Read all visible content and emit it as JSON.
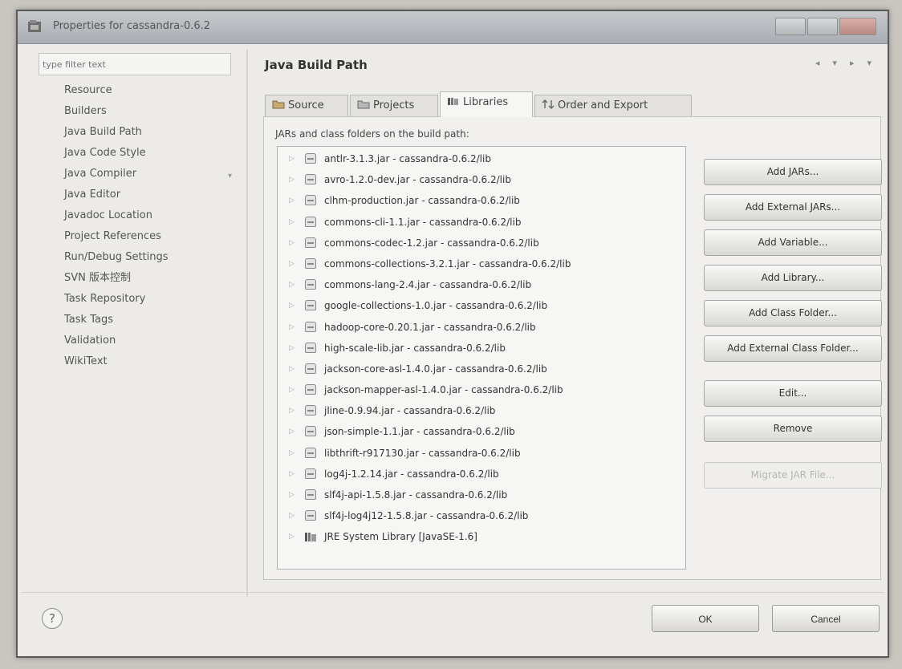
{
  "window": {
    "title": "Properties for cassandra-0.6.2"
  },
  "sidebar": {
    "filter_placeholder": "type filter text",
    "items": [
      {
        "label": "Resource"
      },
      {
        "label": "Builders"
      },
      {
        "label": "Java Build Path"
      },
      {
        "label": "Java Code Style"
      },
      {
        "label": "Java Compiler"
      },
      {
        "label": "Java Editor"
      },
      {
        "label": "Javadoc Location"
      },
      {
        "label": "Project References"
      },
      {
        "label": "Run/Debug Settings"
      },
      {
        "label": "SVN 版本控制"
      },
      {
        "label": "Task Repository"
      },
      {
        "label": "Task Tags"
      },
      {
        "label": "Validation"
      },
      {
        "label": "WikiText"
      }
    ]
  },
  "page": {
    "title": "Java Build Path"
  },
  "tabs": [
    {
      "label": "Source",
      "icon": "source-folder-icon"
    },
    {
      "label": "Projects",
      "icon": "projects-icon"
    },
    {
      "label": "Libraries",
      "icon": "libraries-icon",
      "selected": true
    },
    {
      "label": "Order and Export",
      "icon": "order-export-icon"
    }
  ],
  "libraries": {
    "label": "JARs and class folders on the build path:",
    "items": [
      {
        "label": "antlr-3.1.3.jar - cassandra-0.6.2/lib",
        "icon": "jar-icon"
      },
      {
        "label": "avro-1.2.0-dev.jar - cassandra-0.6.2/lib",
        "icon": "jar-icon"
      },
      {
        "label": "clhm-production.jar - cassandra-0.6.2/lib",
        "icon": "jar-icon"
      },
      {
        "label": "commons-cli-1.1.jar - cassandra-0.6.2/lib",
        "icon": "jar-icon"
      },
      {
        "label": "commons-codec-1.2.jar - cassandra-0.6.2/lib",
        "icon": "jar-icon"
      },
      {
        "label": "commons-collections-3.2.1.jar - cassandra-0.6.2/lib",
        "icon": "jar-icon"
      },
      {
        "label": "commons-lang-2.4.jar - cassandra-0.6.2/lib",
        "icon": "jar-icon"
      },
      {
        "label": "google-collections-1.0.jar - cassandra-0.6.2/lib",
        "icon": "jar-icon"
      },
      {
        "label": "hadoop-core-0.20.1.jar - cassandra-0.6.2/lib",
        "icon": "jar-icon"
      },
      {
        "label": "high-scale-lib.jar - cassandra-0.6.2/lib",
        "icon": "jar-icon"
      },
      {
        "label": "jackson-core-asl-1.4.0.jar - cassandra-0.6.2/lib",
        "icon": "jar-icon"
      },
      {
        "label": "jackson-mapper-asl-1.4.0.jar - cassandra-0.6.2/lib",
        "icon": "jar-icon"
      },
      {
        "label": "jline-0.9.94.jar - cassandra-0.6.2/lib",
        "icon": "jar-icon"
      },
      {
        "label": "json-simple-1.1.jar - cassandra-0.6.2/lib",
        "icon": "jar-icon"
      },
      {
        "label": "libthrift-r917130.jar - cassandra-0.6.2/lib",
        "icon": "jar-icon"
      },
      {
        "label": "log4j-1.2.14.jar - cassandra-0.6.2/lib",
        "icon": "jar-icon"
      },
      {
        "label": "slf4j-api-1.5.8.jar - cassandra-0.6.2/lib",
        "icon": "jar-icon"
      },
      {
        "label": "slf4j-log4j12-1.5.8.jar - cassandra-0.6.2/lib",
        "icon": "jar-icon"
      },
      {
        "label": "JRE System Library [JavaSE-1.6]",
        "icon": "library-icon"
      }
    ]
  },
  "buttons": {
    "add_jars": "Add JARs...",
    "add_external_jars": "Add External JARs...",
    "add_variable": "Add Variable...",
    "add_library": "Add Library...",
    "add_class_folder": "Add Class Folder...",
    "add_external_class_folder": "Add External Class Folder...",
    "edit": "Edit...",
    "remove": "Remove",
    "migrate_jar": "Migrate JAR File..."
  },
  "footer": {
    "help": "?",
    "ok": "OK",
    "cancel": "Cancel"
  }
}
